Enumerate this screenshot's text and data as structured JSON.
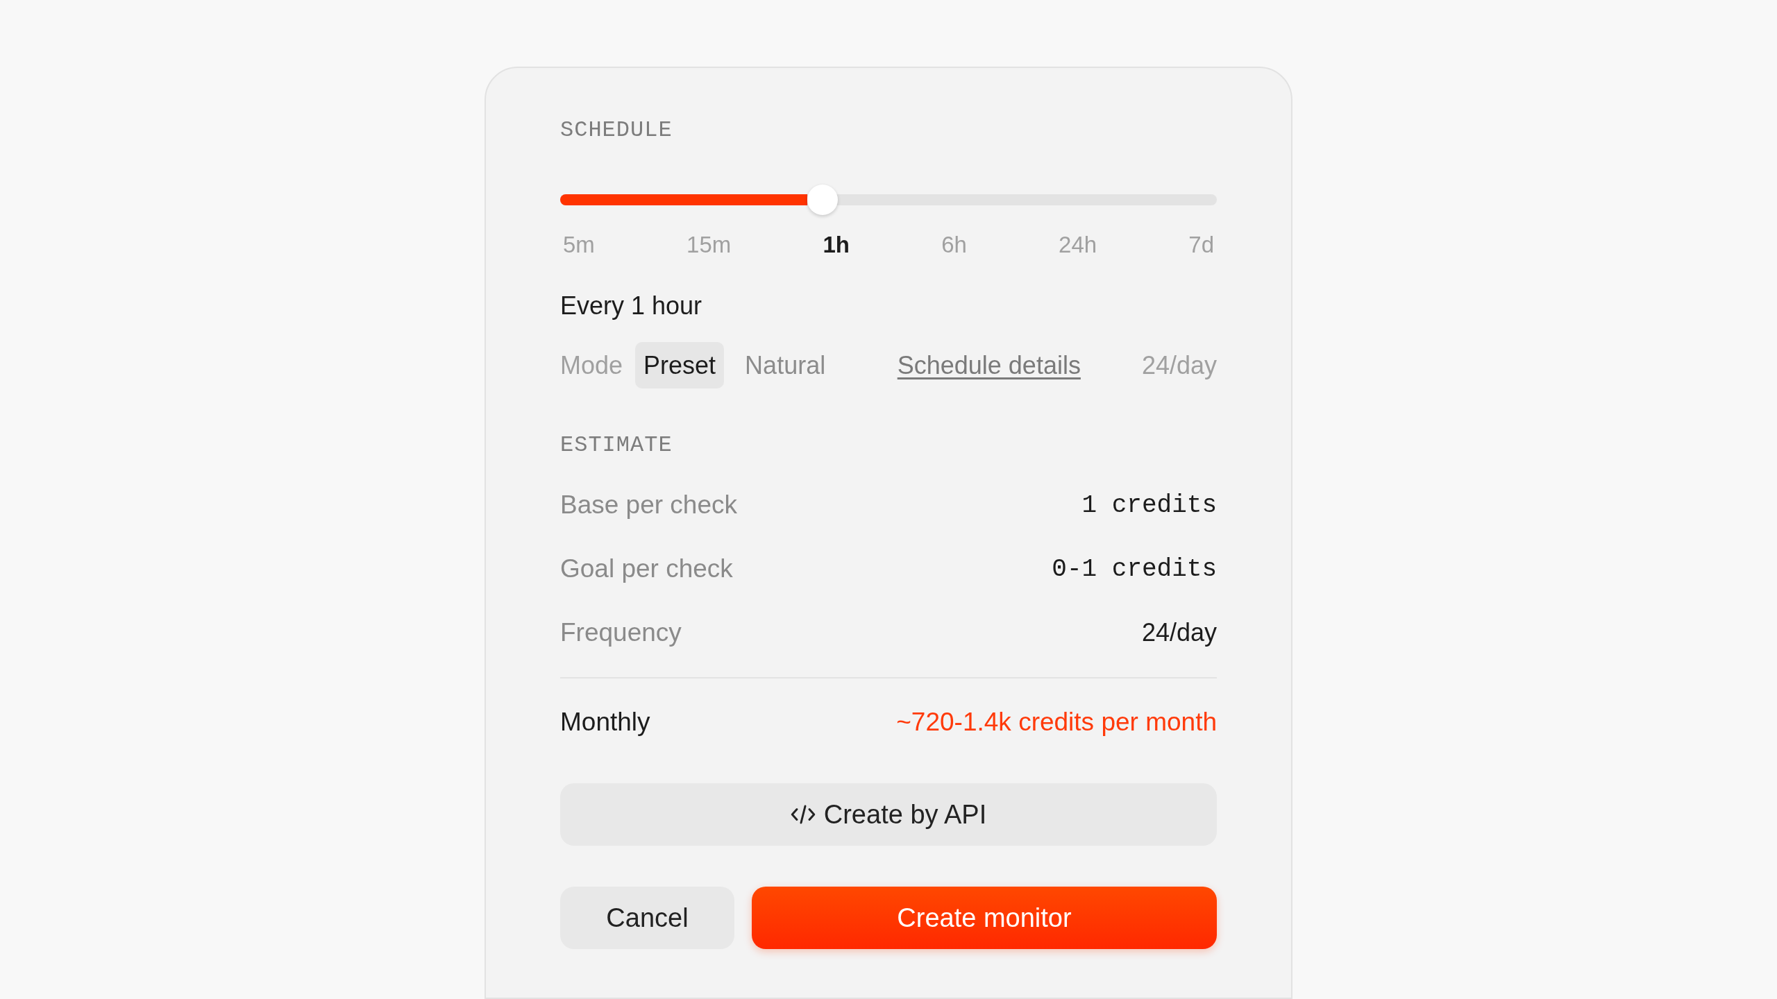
{
  "schedule": {
    "heading": "SCHEDULE",
    "slider": {
      "level": 0.4
    },
    "stops": [
      {
        "label": "5m",
        "selected": false
      },
      {
        "label": "15m",
        "selected": false
      },
      {
        "label": "1h",
        "selected": true
      },
      {
        "label": "6h",
        "selected": false
      },
      {
        "label": "24h",
        "selected": false
      },
      {
        "label": "7d",
        "selected": false
      }
    ],
    "summary": "Every 1 hour",
    "mode": {
      "label": "Mode",
      "options": [
        {
          "label": "Preset",
          "selected": true
        },
        {
          "label": "Natural",
          "selected": false
        }
      ]
    },
    "details_link": "Schedule details",
    "rate": "24/day"
  },
  "estimate": {
    "heading": "ESTIMATE",
    "rows": [
      {
        "label": "Base per check",
        "value": "1 credits",
        "kind": "mono"
      },
      {
        "label": "Goal per check",
        "value": "0-1 credits",
        "kind": "mono"
      },
      {
        "label": "Frequency",
        "value": "24/day",
        "kind": "plain"
      }
    ],
    "total": {
      "label": "Monthly",
      "value": "~720-1.4k credits per month"
    }
  },
  "actions": {
    "api_button": "Create by API",
    "cancel": "Cancel",
    "submit": "Create monitor"
  }
}
